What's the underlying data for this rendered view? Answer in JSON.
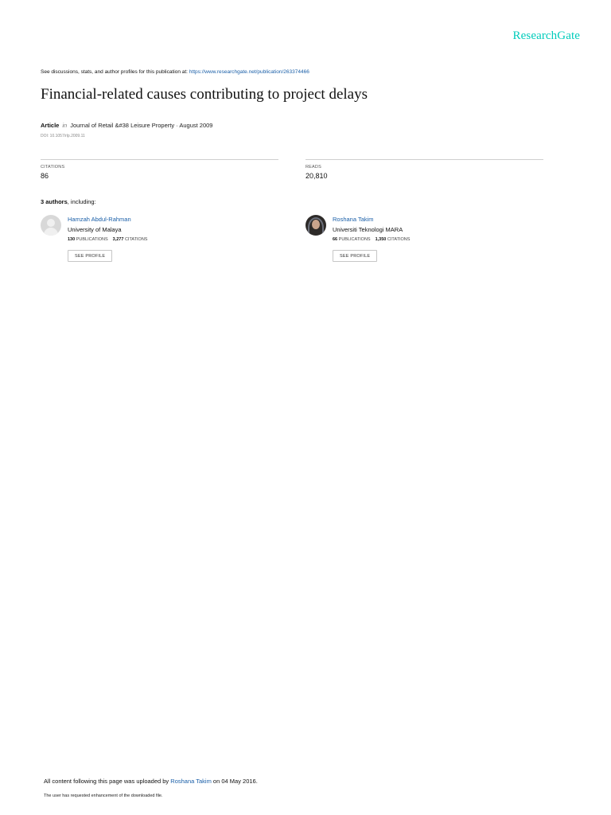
{
  "brand": "ResearchGate",
  "top_note": {
    "prefix": "See discussions, stats, and author profiles for this publication at: ",
    "url": "https://www.researchgate.net/publication/263374466"
  },
  "title": "Financial-related causes contributing to project delays",
  "meta": {
    "type": "Article",
    "in": "in",
    "journal": "Journal of Retail &#38 Leisure Property · August 2009"
  },
  "doi": "DOI: 10.1057/rlp.2009.11",
  "stats": {
    "citations_label": "CITATIONS",
    "citations_value": "86",
    "reads_label": "READS",
    "reads_value": "20,810"
  },
  "authors_heading": {
    "count": "3 authors",
    "suffix": ", including:"
  },
  "authors": [
    {
      "name": "Hamzah Abdul-Rahman",
      "institution": "University of Malaya",
      "publications": "130",
      "publications_label": "PUBLICATIONS",
      "citations": "3,277",
      "citations_label": "CITATIONS",
      "button": "SEE PROFILE"
    },
    {
      "name": "Roshana Takim",
      "institution": "Universiti Teknologi MARA",
      "publications": "66",
      "publications_label": "PUBLICATIONS",
      "citations": "1,350",
      "citations_label": "CITATIONS",
      "button": "SEE PROFILE"
    }
  ],
  "footer": {
    "upload_prefix": "All content following this page was uploaded by ",
    "uploader": "Roshana Takim",
    "upload_suffix": " on 04 May 2016.",
    "note": "The user has requested enhancement of the downloaded file."
  },
  "colors": {
    "brand": "#00ccbb",
    "link": "#1a5fa8"
  }
}
